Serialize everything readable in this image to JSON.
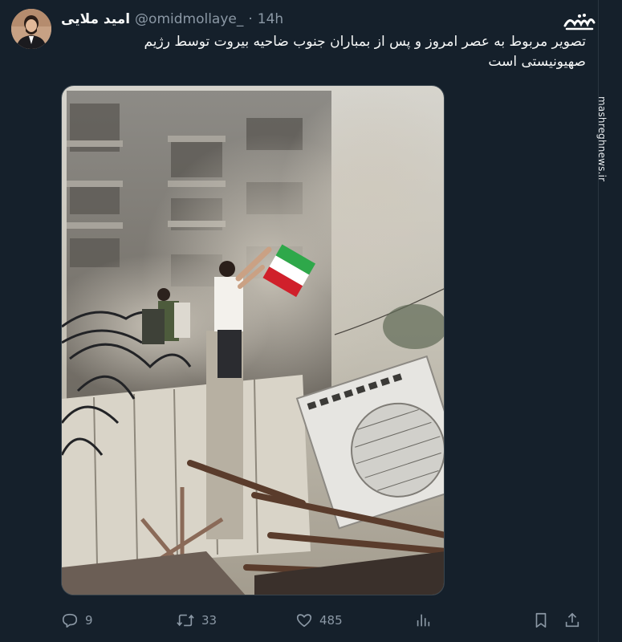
{
  "tweet": {
    "display_name": "امید ملایی",
    "handle": "@omidmollaye_",
    "separator": "·",
    "timestamp": "14h",
    "text": "تصویر مربوط به عصر امروز و پس از بمباران جنوب ضاحیه بیروت توسط رژیم صهیونیستی است",
    "avatar_icon": "person-avatar",
    "media_icon": "photo-image"
  },
  "actions": {
    "reply": {
      "icon": "reply-bubble-icon",
      "count": "9"
    },
    "repost": {
      "icon": "repost-arrows-icon",
      "count": "33"
    },
    "like": {
      "icon": "heart-icon",
      "count": "485"
    },
    "views": {
      "icon": "bar-chart-icon"
    },
    "bookmark": {
      "icon": "bookmark-icon"
    },
    "share": {
      "icon": "share-upload-icon"
    }
  },
  "watermark": {
    "logo": "مشرق",
    "site": "mashreghnews.ir"
  },
  "colors": {
    "background": "#15202b",
    "text": "#f7f9f9",
    "secondary": "#8b98a5",
    "border": "#38444d"
  }
}
